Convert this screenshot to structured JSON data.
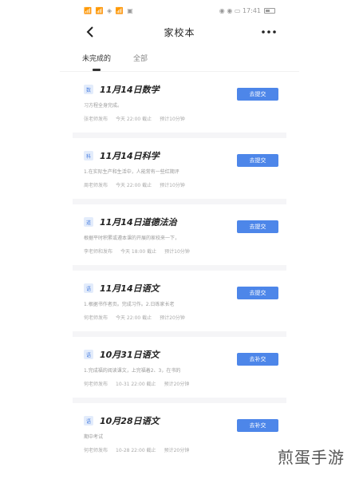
{
  "status": {
    "left": "📶 📶 ◈ 📶 ▣",
    "right": "◉ ◉ ▭ 17:41"
  },
  "nav": {
    "title": "家校本"
  },
  "tabs": [
    {
      "label": "未完成的"
    },
    {
      "label": "全部"
    }
  ],
  "items": [
    {
      "badge": "数",
      "title": "11月14日数学",
      "desc": "习方程全身完成。",
      "meta1": "张老师发布",
      "meta2": "今天 22:00 截止",
      "meta3": "预计10分钟",
      "button": "去提交"
    },
    {
      "badge": "科",
      "title": "11月14日科学",
      "desc": "1.在实际生产和生活中，人能常有一些红期评",
      "meta1": "周老师发布",
      "meta2": "今天 22:00 截止",
      "meta3": "预计10分钟",
      "button": "去提交"
    },
    {
      "badge": "道",
      "title": "11月14日道德法治",
      "desc": "根据平时积累或遵本课的开展的家校来一下，",
      "meta1": "李老师和发布",
      "meta2": "今天 18:00 截止",
      "meta3": "预计10分钟",
      "button": "去提交"
    },
    {
      "badge": "语",
      "title": "11月14日语文",
      "desc": "1.根据书作者页。完成习作。2.日练家长老",
      "meta1": "何老师发布",
      "meta2": "今天 22:00 截止",
      "meta3": "预计20分钟",
      "button": "去提交"
    },
    {
      "badge": "语",
      "title": "10月31日语文",
      "desc": "1.完成福的阅读课文，上完福着2、3，在书的",
      "meta1": "何老师发布",
      "meta2": "10-31 22:00 截止",
      "meta3": "预计20分钟",
      "button": "去补交"
    },
    {
      "badge": "语",
      "title": "10月28日语文",
      "desc": "期中考试",
      "meta1": "何老师发布",
      "meta2": "10-28 22:00 截止",
      "meta3": "预计20分钟",
      "button": "去补交"
    }
  ],
  "watermark": "煎蛋手游"
}
